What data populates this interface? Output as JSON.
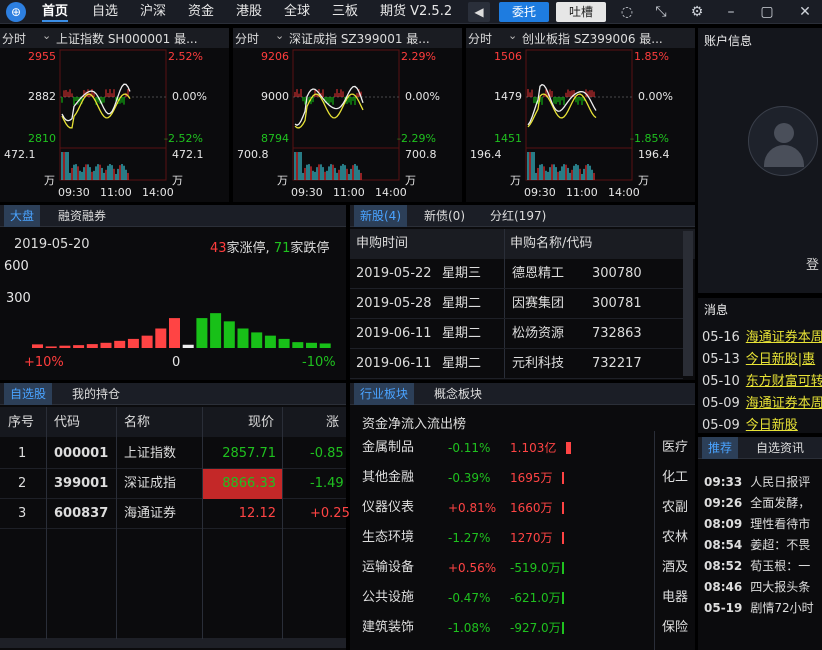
{
  "nav": [
    "首页",
    "自选",
    "沪深",
    "资金",
    "港股",
    "全球",
    "三板",
    "期货 V2.5.2"
  ],
  "toolbar": {
    "entrust": "委托",
    "feedback": "吐槽"
  },
  "mini_charts": [
    {
      "period": "分时",
      "title": "上证指数 SH000001 最...",
      "high": "2955",
      "mid": "2882",
      "low": "2810",
      "pct_up": "2.52%",
      "pct_mid": "0.00%",
      "pct_down": "-2.52%",
      "vol": "472.1",
      "vol_r": "472.1",
      "unit": "万",
      "unit_r": "万",
      "times": [
        "09:30",
        "11:00",
        "14:00"
      ]
    },
    {
      "period": "分时",
      "title": "深证成指 SZ399001 最...",
      "high": "9206",
      "mid": "9000",
      "low": "8794",
      "pct_up": "2.29%",
      "pct_mid": "0.00%",
      "pct_down": "-2.29%",
      "vol": "700.8",
      "vol_r": "700.8",
      "unit": "万",
      "unit_r": "万",
      "times": [
        "09:30",
        "11:00",
        "14:00"
      ]
    },
    {
      "period": "分时",
      "title": "创业板指 SZ399006 最...",
      "high": "1506",
      "mid": "1479",
      "low": "1451",
      "pct_up": "1.85%",
      "pct_mid": "0.00%",
      "pct_down": "-1.85%",
      "vol": "196.4",
      "vol_r": "196.4",
      "unit": "万",
      "unit_r": "万",
      "times": [
        "09:30",
        "11:00",
        "14:00"
      ]
    }
  ],
  "account": {
    "title": "账户信息",
    "login": "登"
  },
  "market": {
    "tabs": [
      "大盘",
      "融资融券"
    ],
    "date": "2019-05-20",
    "up_count": "43",
    "up_label": "家涨停,",
    "down_count": "71",
    "down_label": "家跌停",
    "y600": "600",
    "y300": "300",
    "x_left": "+10%",
    "x_mid": "0",
    "x_right": "-10%"
  },
  "chart_data": {
    "type": "bar",
    "title": "",
    "categories": [
      "+10%",
      "",
      "",
      "",
      "",
      "",
      "",
      "",
      "",
      "",
      "",
      "0",
      "",
      "",
      "",
      "",
      "",
      "",
      "",
      "",
      "",
      "-10%"
    ],
    "values": [
      28,
      12,
      18,
      22,
      30,
      40,
      55,
      70,
      95,
      150,
      230,
      25,
      230,
      268,
      205,
      150,
      120,
      95,
      70,
      45,
      40,
      35
    ],
    "ylim": [
      0,
      700
    ]
  },
  "ipo": {
    "tabs": [
      "新股(4)",
      "新债(0)",
      "分红(197)"
    ],
    "headers": [
      "申购时间",
      "申购名称/代码"
    ],
    "rows": [
      {
        "date": "2019-05-22",
        "week": "星期三",
        "name": "德恩精工",
        "code": "300780"
      },
      {
        "date": "2019-05-28",
        "week": "星期二",
        "name": "因赛集团",
        "code": "300781"
      },
      {
        "date": "2019-06-11",
        "week": "星期二",
        "name": "松炀资源",
        "code": "732863"
      },
      {
        "date": "2019-06-11",
        "week": "星期二",
        "name": "元利科技",
        "code": "732217"
      }
    ]
  },
  "news": {
    "title": "消息",
    "items": [
      {
        "d": "05-16",
        "t": "海通证券本周"
      },
      {
        "d": "05-13",
        "t": "今日新股|惠"
      },
      {
        "d": "05-10",
        "t": "东方财富可转"
      },
      {
        "d": "05-09",
        "t": "海通证券本周"
      },
      {
        "d": "05-09",
        "t": "今日新股"
      }
    ]
  },
  "watch": {
    "tabs": [
      "自选股",
      "我的持仓"
    ],
    "headers": [
      "序号",
      "代码",
      "名称",
      "现价",
      "涨"
    ],
    "rows": [
      {
        "no": "1",
        "code": "000001",
        "name": "上证指数",
        "price": "2857.71",
        "chg": "-0.85"
      },
      {
        "no": "2",
        "code": "399001",
        "name": "深证成指",
        "price": "8866.33",
        "chg": "-1.49"
      },
      {
        "no": "3",
        "code": "600837",
        "name": "海通证券",
        "price": "12.12",
        "chg": "+0.25"
      }
    ]
  },
  "sector": {
    "tabs": [
      "行业板块",
      "概念板块"
    ],
    "title": "资金净流入流出榜",
    "rows": [
      {
        "name": "金属制品",
        "pct": "-0.11%",
        "amt": "1.103亿",
        "side": "医疗"
      },
      {
        "name": "其他金融",
        "pct": "-0.39%",
        "amt": "1695万",
        "side": "化工"
      },
      {
        "name": "仪器仪表",
        "pct": "+0.81%",
        "amt": "1660万",
        "side": "农副"
      },
      {
        "name": "生态环境",
        "pct": "-1.27%",
        "amt": "1270万",
        "side": "农林"
      },
      {
        "name": "运输设备",
        "pct": "+0.56%",
        "amt": "-519.0万",
        "side": "酒及"
      },
      {
        "name": "公共设施",
        "pct": "-0.47%",
        "amt": "-621.0万",
        "side": "电器"
      },
      {
        "name": "建筑装饰",
        "pct": "-1.08%",
        "amt": "-927.0万",
        "side": "保险"
      }
    ]
  },
  "info": {
    "tabs": [
      "推荐",
      "自选资讯"
    ],
    "items": [
      {
        "t": "09:33",
        "s": "人民日报评"
      },
      {
        "t": "09:26",
        "s": "全面发酵，"
      },
      {
        "t": "08:09",
        "s": "理性看待市"
      },
      {
        "t": "08:54",
        "s": "姜超：不畏"
      },
      {
        "t": "08:52",
        "s": "荀玉根：一"
      },
      {
        "t": "08:46",
        "s": "四大报头条"
      },
      {
        "t": "05-19",
        "s": "剧情72小时"
      }
    ]
  }
}
